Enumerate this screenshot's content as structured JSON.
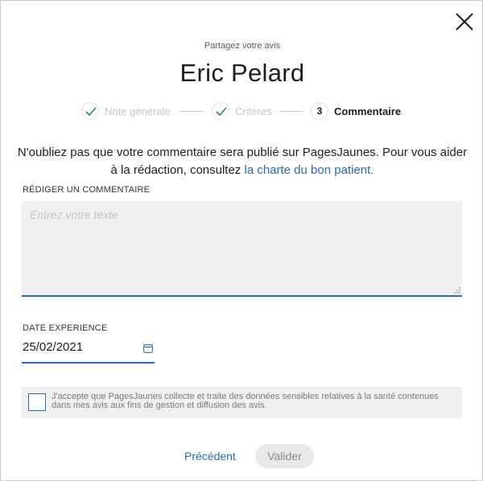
{
  "header": {
    "kicker": "Partagez votre avis",
    "title": "Eric Pelard"
  },
  "steps": [
    {
      "label": "Note générale",
      "status": "done"
    },
    {
      "label": "Critères",
      "status": "done"
    },
    {
      "number": "3",
      "label": "Commentaire",
      "status": "active"
    }
  ],
  "intro": {
    "text": "N'oubliez pas que votre commentaire sera publié sur PagesJaunes. Pour vous aider à la rédaction, consultez ",
    "link": "la charte du bon patient."
  },
  "comment": {
    "label": "RÉDIGER UN COMMENTAIRE",
    "placeholder": "Entrez votre texte",
    "value": ""
  },
  "date": {
    "label": "DATE EXPERIENCE",
    "value": "25/02/2021"
  },
  "consent": {
    "text": "J'accepte que PagesJaunes collecte et traite des données sensibles relatives à la santé contenues dans mes avis aux fins de gestion et diffusion des avis.",
    "checked": false
  },
  "footer": {
    "previous": "Précédent",
    "submit": "Valider"
  },
  "colors": {
    "accent": "#2a6ab8",
    "check": "#2e8b3d",
    "field_bg": "#f0f0f0"
  }
}
